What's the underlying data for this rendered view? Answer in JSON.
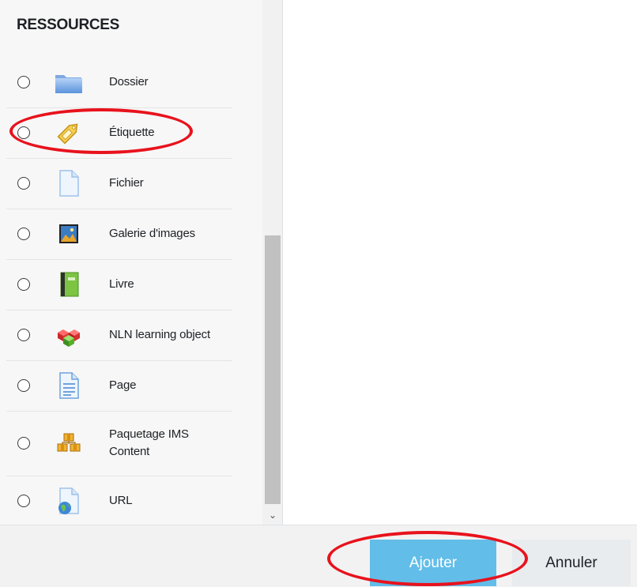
{
  "section": {
    "title": "RESSOURCES"
  },
  "resources": [
    {
      "label": "Dossier",
      "icon": "folder-icon"
    },
    {
      "label": "Étiquette",
      "icon": "tag-icon"
    },
    {
      "label": "Fichier",
      "icon": "file-icon"
    },
    {
      "label": "Galerie d'images",
      "icon": "image-gallery-icon"
    },
    {
      "label": "Livre",
      "icon": "book-icon"
    },
    {
      "label": "NLN learning object",
      "icon": "cubes-icon"
    },
    {
      "label": "Page",
      "icon": "page-icon"
    },
    {
      "label": "Paquetage IMS Content",
      "icon": "ims-package-icon"
    },
    {
      "label": "URL",
      "icon": "url-icon"
    }
  ],
  "footer": {
    "add_label": "Ajouter",
    "cancel_label": "Annuler"
  },
  "scrollbar": {
    "down_glyph": "⌄"
  },
  "colors": {
    "annotation": "#e8121c",
    "add_button": "#62bde9"
  }
}
